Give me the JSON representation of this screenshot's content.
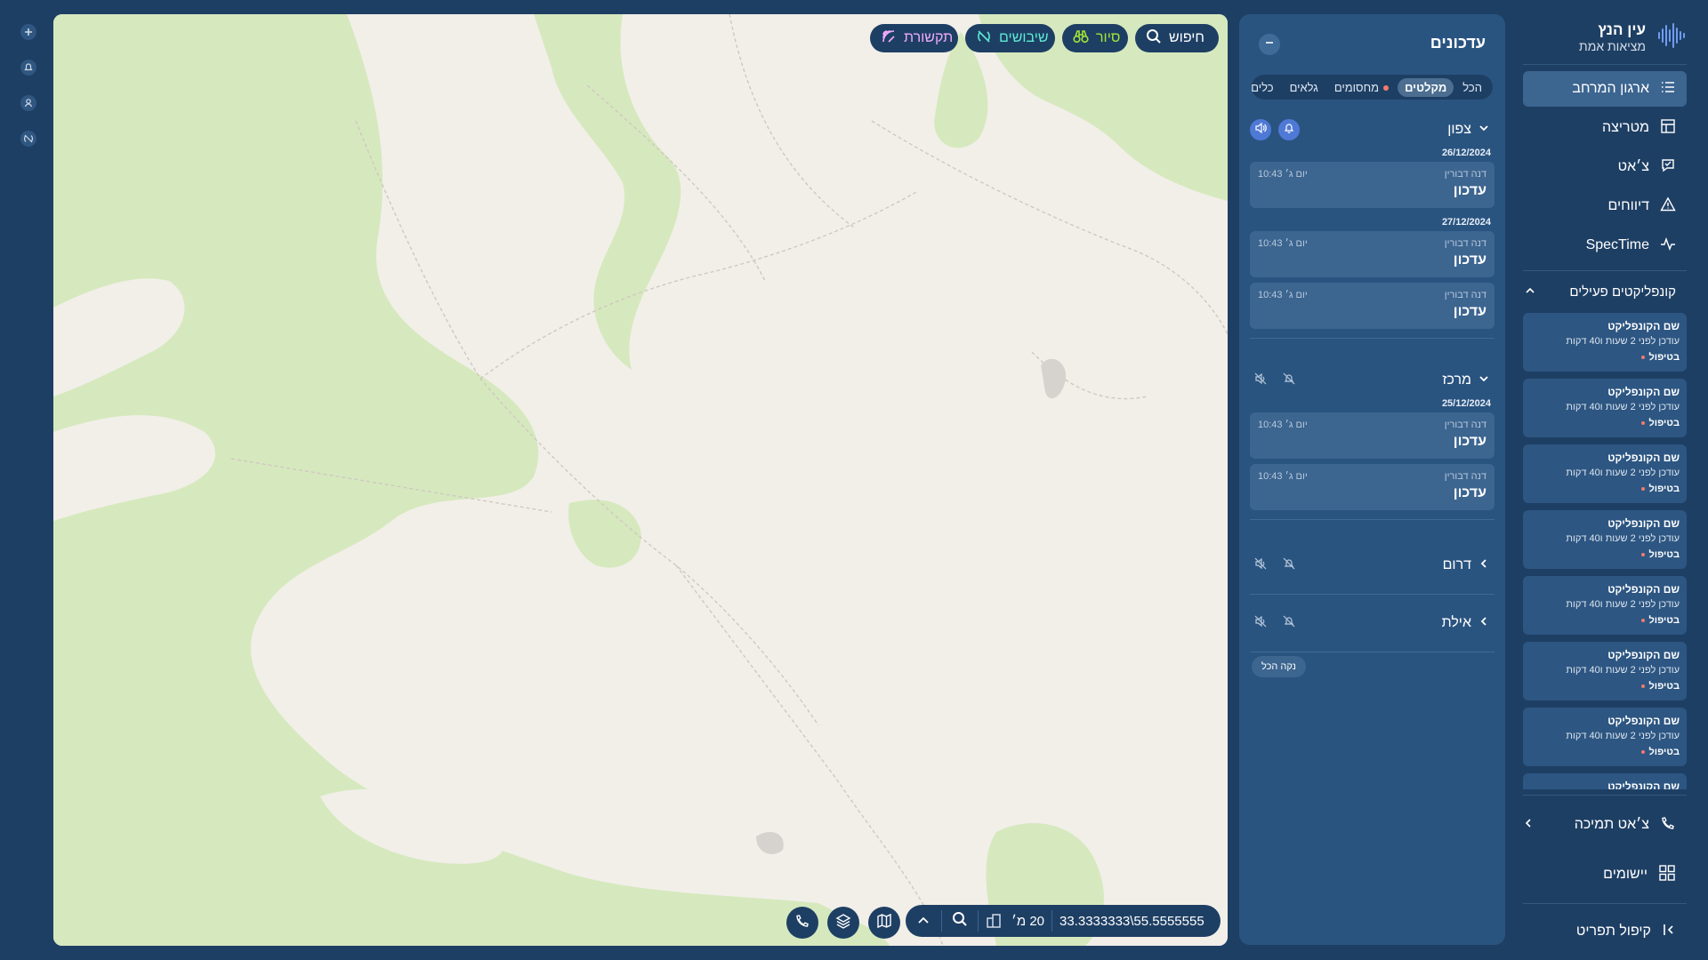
{
  "brand": {
    "title": "עין הנץ",
    "subtitle": "מציאות אמת"
  },
  "nav": {
    "items": [
      {
        "label": "ארגון המרחב",
        "icon": "list-icon",
        "active": true
      },
      {
        "label": "מטריצה",
        "icon": "table-icon"
      },
      {
        "label": "צ׳אט",
        "icon": "chat-icon"
      },
      {
        "label": "דיווחים",
        "icon": "warning-icon"
      },
      {
        "label": "SpecTime",
        "icon": "pulse-icon"
      }
    ],
    "conflicts_header": "קונפליקטים פעילים",
    "conflicts": [
      {
        "title": "שם הקונפליקט",
        "subtitle": "עודכן לפני 2 שעות ו40 דקות",
        "status": "בטיפול"
      },
      {
        "title": "שם הקונפליקט",
        "subtitle": "עודכן לפני 2 שעות ו40 דקות",
        "status": "בטיפול"
      },
      {
        "title": "שם הקונפליקט",
        "subtitle": "עודכן לפני 2 שעות ו40 דקות",
        "status": "בטיפול"
      },
      {
        "title": "שם הקונפליקט",
        "subtitle": "עודכן לפני 2 שעות ו40 דקות",
        "status": "בטיפול"
      },
      {
        "title": "שם הקונפליקט",
        "subtitle": "עודכן לפני 2 שעות ו40 דקות",
        "status": "בטיפול"
      },
      {
        "title": "שם הקונפליקט",
        "subtitle": "עודכן לפני 2 שעות ו40 דקות",
        "status": "בטיפול"
      },
      {
        "title": "שם הקונפליקט",
        "subtitle": "עודכן לפני 2 שעות ו40 דקות",
        "status": "בטיפול"
      },
      {
        "title": "שם הקונפליקט",
        "subtitle": "",
        "status": ""
      }
    ],
    "support_chat": "צ׳אט תמיכה",
    "apps": "יישומים",
    "collapse_menu": "קיפול תפריט"
  },
  "updates": {
    "title": "עדכונים",
    "filters": [
      {
        "label": "הכל"
      },
      {
        "label": "מקלטים",
        "active": true
      },
      {
        "label": "מחסומים",
        "dot": true
      },
      {
        "label": "גלאים"
      },
      {
        "label": "כלים"
      }
    ],
    "regions": [
      {
        "name": "צפון",
        "expanded": true,
        "active": true,
        "groups": [
          {
            "date": "26/12/2024",
            "cards": [
              {
                "author": "דנה דבורין",
                "time": "יום ג׳ 10:43",
                "text": "עדכון"
              }
            ]
          },
          {
            "date": "27/12/2024",
            "cards": [
              {
                "author": "דנה דבורין",
                "time": "יום ג׳ 10:43",
                "text": "עדכון"
              },
              {
                "author": "דנה דבורין",
                "time": "יום ג׳ 10:43",
                "text": "עדכון"
              }
            ]
          }
        ]
      },
      {
        "name": "מרכז",
        "expanded": true,
        "active": false,
        "groups": [
          {
            "date": "25/12/2024",
            "cards": [
              {
                "author": "דנה דבורין",
                "time": "יום ג׳ 10:43",
                "text": "עדכון"
              },
              {
                "author": "דנה דבורין",
                "time": "יום ג׳ 10:43",
                "text": "עדכון"
              }
            ]
          }
        ]
      },
      {
        "name": "דרום",
        "expanded": false,
        "active": false,
        "groups": []
      },
      {
        "name": "אילת",
        "expanded": false,
        "active": false,
        "groups": []
      }
    ],
    "clear_all": "נקה הכל"
  },
  "map": {
    "top_buttons": [
      {
        "label": "חיפוש",
        "icon": "search-icon",
        "color": "#ffffff"
      },
      {
        "label": "סיור",
        "icon": "binoculars-icon",
        "color": "#a3e635"
      },
      {
        "label": "שיבושים",
        "icon": "signal-off-icon",
        "color": "#5eead4"
      },
      {
        "label": "תקשורת",
        "icon": "signal-icon",
        "color": "#f0abfc"
      }
    ],
    "coordinates": "33.3333333\\55.5555555",
    "scale": "20 מ׳"
  },
  "colors": {
    "bg": "#1e3f64",
    "panel": "#2a5480",
    "card": "#3c6590",
    "accent": "#4f79d6",
    "map_land": "#f2efe9",
    "map_green": "#d6e9be"
  }
}
